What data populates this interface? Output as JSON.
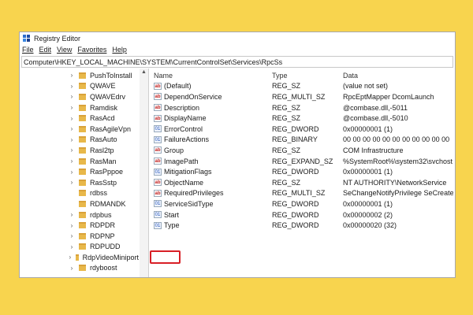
{
  "window": {
    "title": "Registry Editor",
    "address": "Computer\\HKEY_LOCAL_MACHINE\\SYSTEM\\CurrentControlSet\\Services\\RpcSs"
  },
  "menu": [
    "File",
    "Edit",
    "View",
    "Favorites",
    "Help"
  ],
  "tree": {
    "items": [
      {
        "label": "PushToInstall",
        "expandable": true
      },
      {
        "label": "QWAVE",
        "expandable": true
      },
      {
        "label": "QWAVEdrv",
        "expandable": true
      },
      {
        "label": "Ramdisk",
        "expandable": true
      },
      {
        "label": "RasAcd",
        "expandable": true
      },
      {
        "label": "RasAgileVpn",
        "expandable": true
      },
      {
        "label": "RasAuto",
        "expandable": true
      },
      {
        "label": "Rasl2tp",
        "expandable": true
      },
      {
        "label": "RasMan",
        "expandable": true
      },
      {
        "label": "RasPppoe",
        "expandable": true
      },
      {
        "label": "RasSstp",
        "expandable": true
      },
      {
        "label": "rdbss",
        "expandable": false
      },
      {
        "label": "RDMANDK",
        "expandable": false
      },
      {
        "label": "rdpbus",
        "expandable": true
      },
      {
        "label": "RDPDR",
        "expandable": true
      },
      {
        "label": "RDPNP",
        "expandable": true
      },
      {
        "label": "RDPUDD",
        "expandable": true
      },
      {
        "label": "RdpVideoMiniport",
        "expandable": true
      },
      {
        "label": "rdyboost",
        "expandable": true
      }
    ]
  },
  "values": {
    "headers": {
      "name": "Name",
      "type": "Type",
      "data": "Data"
    },
    "rows": [
      {
        "name": "(Default)",
        "type": "REG_SZ",
        "data": "(value not set)",
        "icon": "string-value-icon"
      },
      {
        "name": "DependOnService",
        "type": "REG_MULTI_SZ",
        "data": "RpcEptMapper DcomLaunch",
        "icon": "string-value-icon"
      },
      {
        "name": "Description",
        "type": "REG_SZ",
        "data": "@combase.dll,-5011",
        "icon": "string-value-icon"
      },
      {
        "name": "DisplayName",
        "type": "REG_SZ",
        "data": "@combase.dll,-5010",
        "icon": "string-value-icon"
      },
      {
        "name": "ErrorControl",
        "type": "REG_DWORD",
        "data": "0x00000001 (1)",
        "icon": "binary-value-icon"
      },
      {
        "name": "FailureActions",
        "type": "REG_BINARY",
        "data": "00 00 00 00 00 00 00 00 00 00 00",
        "icon": "binary-value-icon"
      },
      {
        "name": "Group",
        "type": "REG_SZ",
        "data": "COM Infrastructure",
        "icon": "string-value-icon"
      },
      {
        "name": "ImagePath",
        "type": "REG_EXPAND_SZ",
        "data": "%SystemRoot%\\system32\\svchost",
        "icon": "string-value-icon"
      },
      {
        "name": "MitigationFlags",
        "type": "REG_DWORD",
        "data": "0x00000001 (1)",
        "icon": "binary-value-icon"
      },
      {
        "name": "ObjectName",
        "type": "REG_SZ",
        "data": "NT AUTHORITY\\NetworkService",
        "icon": "string-value-icon"
      },
      {
        "name": "RequiredPrivileges",
        "type": "REG_MULTI_SZ",
        "data": "SeChangeNotifyPrivilege SeCreate",
        "icon": "string-value-icon"
      },
      {
        "name": "ServiceSidType",
        "type": "REG_DWORD",
        "data": "0x00000001 (1)",
        "icon": "binary-value-icon"
      },
      {
        "name": "Start",
        "type": "REG_DWORD",
        "data": "0x00000002 (2)",
        "icon": "binary-value-icon"
      },
      {
        "name": "Type",
        "type": "REG_DWORD",
        "data": "0x00000020 (32)",
        "icon": "binary-value-icon"
      }
    ]
  },
  "colors": {
    "background": "#f8d44e",
    "highlight": "#d81f26",
    "folder": "#e8b84a"
  }
}
